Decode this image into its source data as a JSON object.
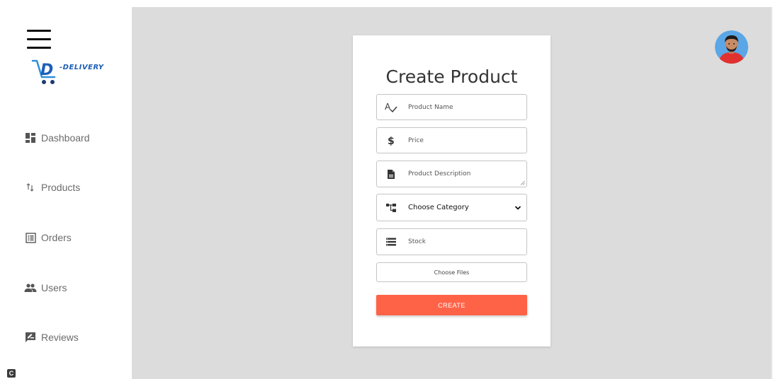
{
  "brand": {
    "logo_text": "-DELIVERY",
    "logo_mark": "D",
    "accent_color": "#1d5fb8",
    "cart_color": "#2f8fd8"
  },
  "sidebar": {
    "items": [
      {
        "label": "Dashboard",
        "icon": "dashboard-icon"
      },
      {
        "label": "Products",
        "icon": "import-export-icon"
      },
      {
        "label": "Orders",
        "icon": "list-alt-icon"
      },
      {
        "label": "Users",
        "icon": "people-icon"
      },
      {
        "label": "Reviews",
        "icon": "rate-review-icon"
      }
    ],
    "corner_badge": "C"
  },
  "form": {
    "title": "Create Product",
    "fields": {
      "name": {
        "placeholder": "Product Name",
        "icon": "spellcheck-icon"
      },
      "price": {
        "placeholder": "Price",
        "icon": "dollar-icon"
      },
      "description": {
        "placeholder": "Product Description",
        "icon": "description-icon"
      },
      "category": {
        "selected": "Choose Category",
        "icon": "account-tree-icon"
      },
      "stock": {
        "placeholder": "Stock",
        "icon": "storage-icon"
      }
    },
    "file_button_label": "Choose Files",
    "submit_label": "CREATE",
    "submit_color": "#ff6347"
  },
  "colors": {
    "main_background": "#dcdcdc",
    "card_background": "#ffffff"
  }
}
